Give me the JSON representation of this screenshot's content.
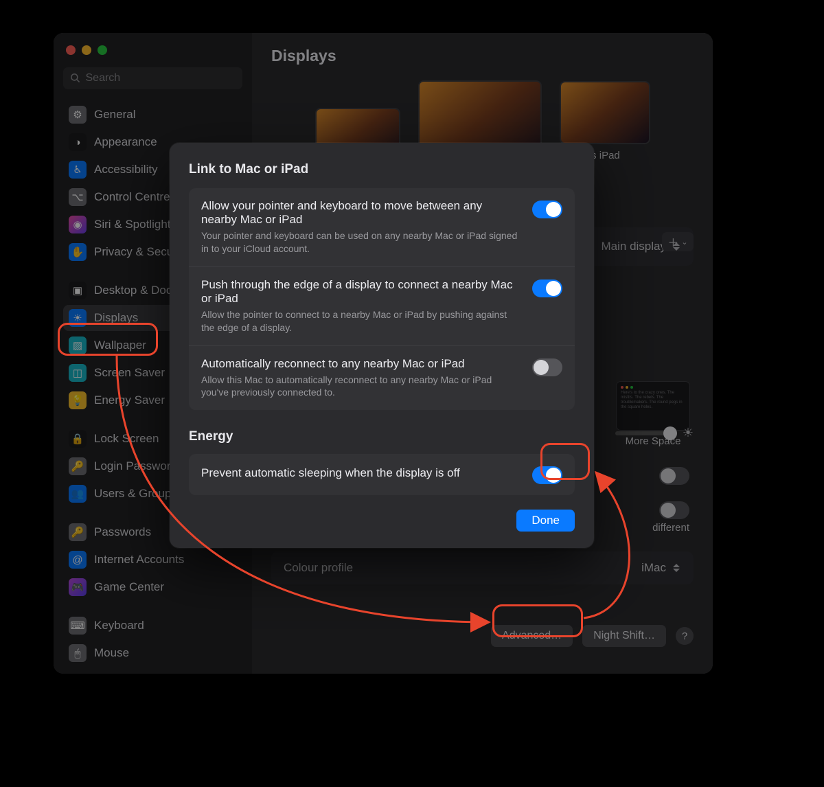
{
  "window_title": "Displays",
  "search_placeholder": "Search",
  "sidebar_groups": [
    [
      {
        "label": "General",
        "icon": "⚙︎",
        "bg": "#6e6e74",
        "name": "general"
      },
      {
        "label": "Appearance",
        "icon": "◑",
        "bg": "#1c1c1e",
        "name": "appearance"
      },
      {
        "label": "Accessibility",
        "icon": "♿︎",
        "bg": "#0a7aff",
        "name": "accessibility"
      },
      {
        "label": "Control Centre",
        "icon": "⌥",
        "bg": "#6e6e74",
        "name": "control-centre"
      },
      {
        "label": "Siri & Spotlight",
        "icon": "◉",
        "bg": "linear-gradient(135deg,#e94ca4,#6a3fe8)",
        "name": "siri-spotlight"
      },
      {
        "label": "Privacy & Security",
        "icon": "✋",
        "bg": "#0a7aff",
        "name": "privacy-security"
      }
    ],
    [
      {
        "label": "Desktop & Dock",
        "icon": "▣",
        "bg": "#1c1c1e",
        "name": "desktop-dock"
      },
      {
        "label": "Displays",
        "icon": "☀︎",
        "bg": "#0a7aff",
        "name": "displays",
        "selected": true
      },
      {
        "label": "Wallpaper",
        "icon": "▨",
        "bg": "#19b7c6",
        "name": "wallpaper"
      },
      {
        "label": "Screen Saver",
        "icon": "◫",
        "bg": "#19b7c6",
        "name": "screen-saver"
      },
      {
        "label": "Energy Saver",
        "icon": "💡",
        "bg": "#f7c02c",
        "name": "energy-saver"
      }
    ],
    [
      {
        "label": "Lock Screen",
        "icon": "🔒",
        "bg": "#1c1c1e",
        "name": "lock-screen"
      },
      {
        "label": "Login Password",
        "icon": "🔑",
        "bg": "#6e6e74",
        "name": "login-password"
      },
      {
        "label": "Users & Groups",
        "icon": "👥",
        "bg": "#0a7aff",
        "name": "users-groups"
      }
    ],
    [
      {
        "label": "Passwords",
        "icon": "🔑",
        "bg": "#6e6e74",
        "name": "passwords"
      },
      {
        "label": "Internet Accounts",
        "icon": "@",
        "bg": "#0a7aff",
        "name": "internet-accounts"
      },
      {
        "label": "Game Center",
        "icon": "🎮",
        "bg": "linear-gradient(135deg,#b84bd8,#5a3fe8)",
        "name": "game-center"
      }
    ],
    [
      {
        "label": "Keyboard",
        "icon": "⌨︎",
        "bg": "#6e6e74",
        "name": "keyboard"
      },
      {
        "label": "Mouse",
        "icon": "🖱",
        "bg": "#6e6e74",
        "name": "mouse"
      }
    ]
  ],
  "displays": {
    "ipad_label": "'s iPad",
    "use_as_label": "Main display",
    "more_space_label": "More Space",
    "different_label": "different",
    "colour_profile_label": "Colour profile",
    "colour_profile_value": "iMac",
    "advanced_btn": "Advanced…",
    "night_shift_btn": "Night Shift…"
  },
  "modal": {
    "section1_title": "Link to Mac or iPad",
    "rows": [
      {
        "title": "Allow your pointer and keyboard to move between any nearby Mac or iPad",
        "sub": "Your pointer and keyboard can be used on any nearby Mac or iPad signed in to your iCloud account.",
        "on": true
      },
      {
        "title": "Push through the edge of a display to connect a nearby Mac or iPad",
        "sub": "Allow the pointer to connect to a nearby Mac or iPad by pushing against the edge of a display.",
        "on": true
      },
      {
        "title": "Automatically reconnect to any nearby Mac or iPad",
        "sub": "Allow this Mac to automatically reconnect to any nearby Mac or iPad you've previously connected to.",
        "on": false
      }
    ],
    "section2_title": "Energy",
    "energy_row": {
      "title": "Prevent automatic sleeping when the display is off",
      "on": true
    },
    "done_label": "Done"
  },
  "colors": {
    "accent": "#0a7aff",
    "annotation": "#e8442c"
  }
}
